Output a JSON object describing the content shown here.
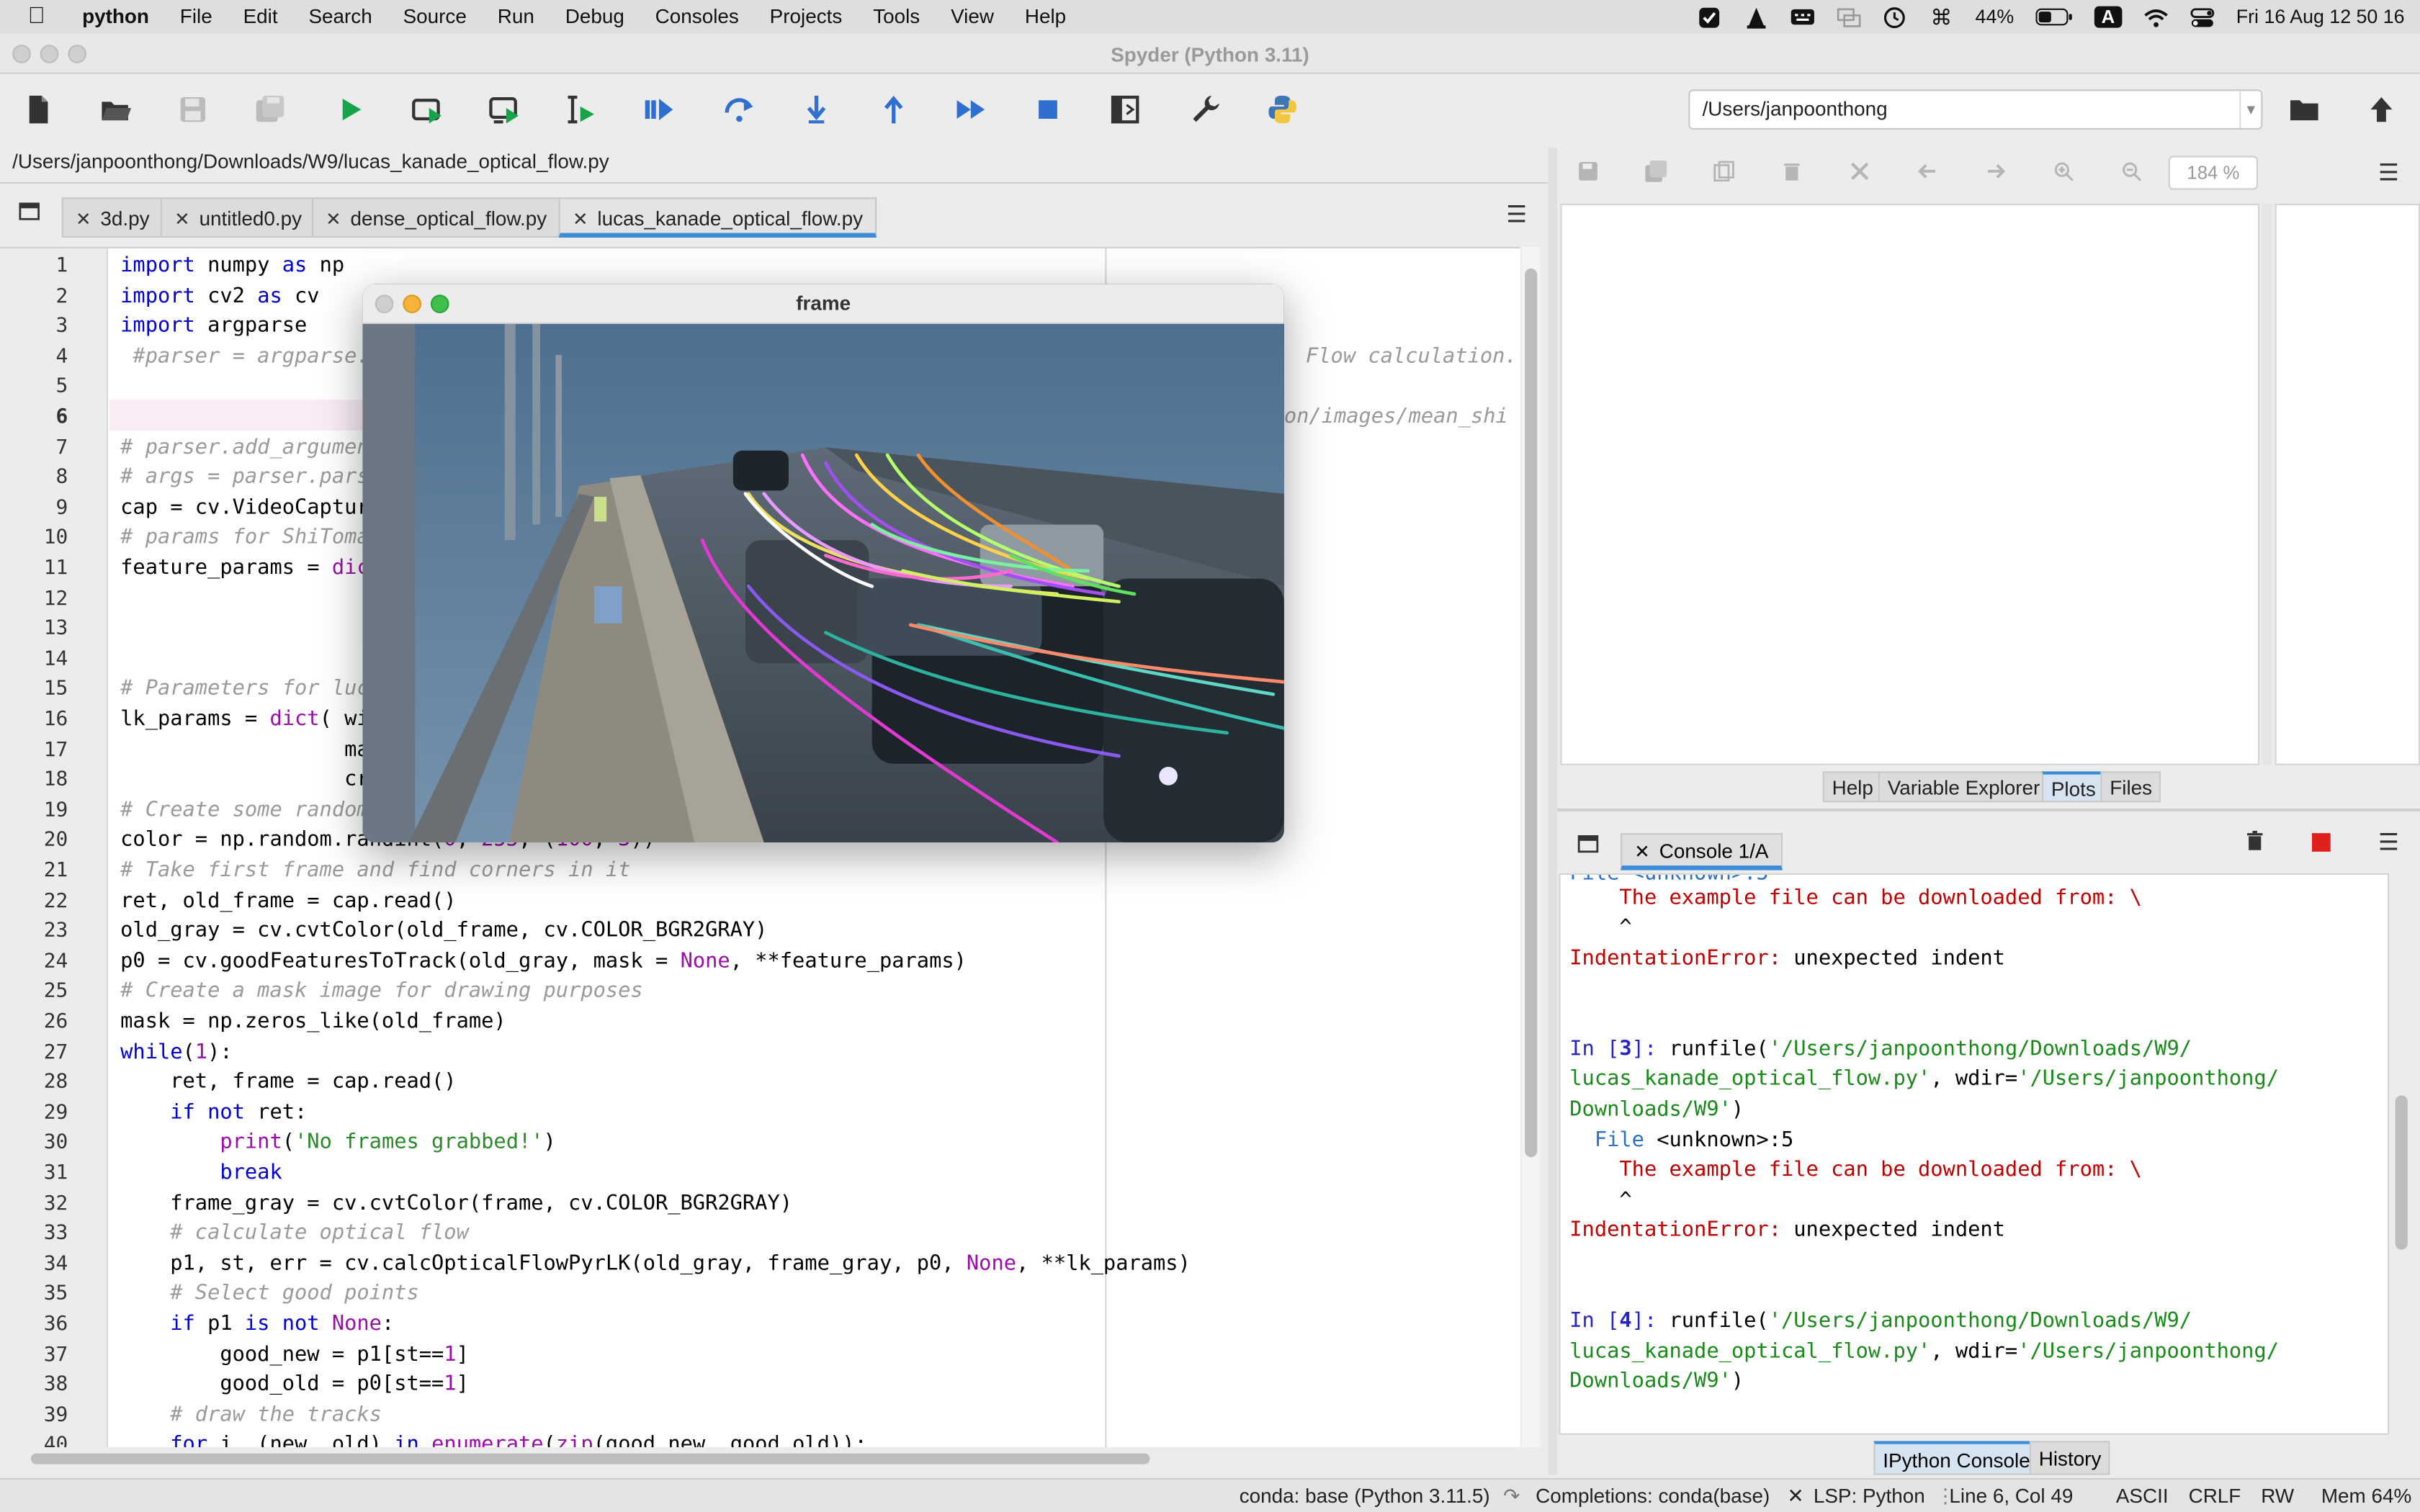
{
  "menubar": {
    "app": "python",
    "items": [
      "File",
      "Edit",
      "Search",
      "Source",
      "Run",
      "Debug",
      "Consoles",
      "Projects",
      "Tools",
      "View",
      "Help"
    ],
    "battery": "44%",
    "input_source": "A",
    "datetime": "Fri 16 Aug  12 50 16"
  },
  "window": {
    "title": "Spyder (Python 3.11)"
  },
  "toolbar": {
    "working_dir": "/Users/janpoonthong"
  },
  "editor": {
    "file_path": "/Users/janpoonthong/Downloads/W9/lucas_kanade_optical_flow.py",
    "tabs": [
      "3d.py",
      "untitled0.py",
      "dense_optical_flow.py",
      "lucas_kanade_optical_flow.py"
    ],
    "active_tab": 3,
    "right_fragments": [
      " Flow calculation.",
      "on/images/mean_shi"
    ]
  },
  "frame_window": {
    "title": "frame"
  },
  "plots": {
    "zoom": "184 %",
    "tabs": [
      "Help",
      "Variable Explorer",
      "Plots",
      "Files"
    ]
  },
  "console": {
    "tab": "Console 1/A",
    "partial_top": "File <unknown>:5",
    "bottom_tabs": [
      "IPython Console",
      "History"
    ]
  },
  "statusbar": {
    "conda": "conda: base (Python 3.11.5)",
    "completions": "Completions: conda(base)",
    "lsp": "LSP: Python",
    "position": "Line 6, Col 49",
    "encoding": "ASCII",
    "eol": "CRLF",
    "rw": "RW",
    "mem": "Mem 64%"
  }
}
